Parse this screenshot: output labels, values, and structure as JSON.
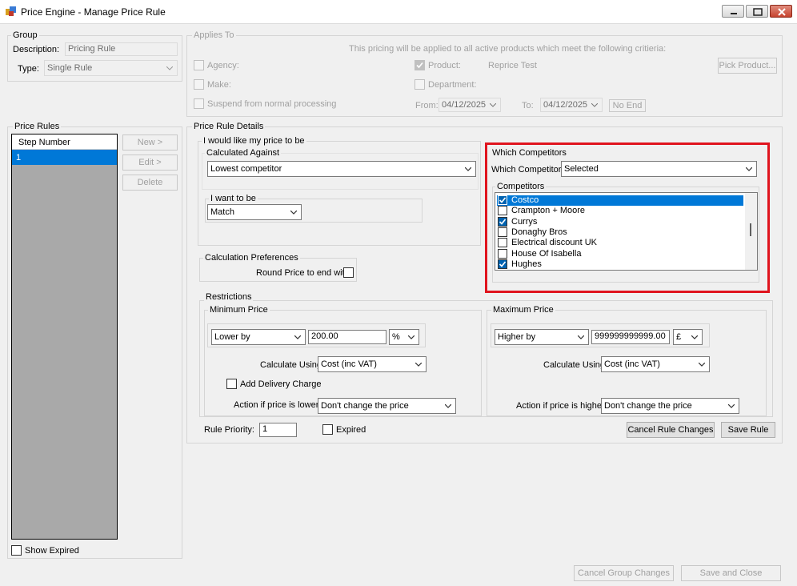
{
  "window": {
    "title": "Price Engine - Manage Price Rule"
  },
  "group": {
    "legend": "Group",
    "description_label": "Description:",
    "description_value": "Pricing Rule",
    "type_label": "Type:",
    "type_value": "Single Rule"
  },
  "applies_to": {
    "legend": "Applies To",
    "info": "This pricing will be applied to all active products which meet the following critieria:",
    "agency_label": "Agency:",
    "make_label": "Make:",
    "suspend_label": "Suspend from normal processing",
    "product_label": "Product:",
    "product_value": "Reprice Test",
    "department_label": "Department:",
    "pick_product_button": "Pick Product...",
    "from_label": "From:",
    "from_value": "04/12/2025",
    "to_label": "To:",
    "to_value": "04/12/2025",
    "no_end_button": "No End"
  },
  "price_rules": {
    "legend": "Price Rules",
    "column_header": "Step Number",
    "rows": [
      "1"
    ],
    "new_button": "New >",
    "edit_button": "Edit >",
    "delete_button": "Delete",
    "show_expired_label": "Show Expired"
  },
  "details": {
    "legend": "Price Rule Details",
    "want_legend": "I would like my price to be",
    "calc_against_legend": "Calculated Against",
    "calc_against_value": "Lowest competitor",
    "i_want_legend": "I want to be",
    "i_want_value": "Match",
    "calc_prefs_legend": "Calculation Preferences",
    "round_label": "Round Price to end with"
  },
  "competitors": {
    "legend": "Which Competitors",
    "which_label": "Which Competitors:",
    "which_value": "Selected",
    "list_legend": "Competitors",
    "items": [
      {
        "name": "Costco",
        "checked": true,
        "selected": true
      },
      {
        "name": "Crampton + Moore",
        "checked": false,
        "selected": false
      },
      {
        "name": "Currys",
        "checked": true,
        "selected": false
      },
      {
        "name": "Donaghy Bros",
        "checked": false,
        "selected": false
      },
      {
        "name": "Electrical discount UK",
        "checked": false,
        "selected": false
      },
      {
        "name": "House Of Isabella",
        "checked": false,
        "selected": false
      },
      {
        "name": "Hughes",
        "checked": true,
        "selected": false
      }
    ]
  },
  "restrictions": {
    "legend": "Restrictions",
    "min": {
      "legend": "Minimum Price",
      "direction": "Lower by",
      "amount": "200.00",
      "unit": "%",
      "calc_using_label": "Calculate Using:",
      "calc_using_value": "Cost (inc VAT)",
      "add_delivery_label": "Add Delivery Charge",
      "action_label": "Action if price is lower:",
      "action_value": "Don't change the price"
    },
    "max": {
      "legend": "Maximum Price",
      "direction": "Higher by",
      "amount": "999999999999.00",
      "unit": "£",
      "calc_using_label": "Calculate Using:",
      "calc_using_value": "Cost (inc VAT)",
      "action_label": "Action if price is higher:",
      "action_value": "Don't change the price"
    }
  },
  "rule_footer": {
    "priority_label": "Rule Priority:",
    "priority_value": "1",
    "expired_label": "Expired",
    "cancel_rule_button": "Cancel Rule Changes",
    "save_rule_button": "Save Rule"
  },
  "footer": {
    "cancel_group_button": "Cancel Group Changes",
    "save_close_button": "Save and Close"
  },
  "colors": {
    "highlight_border": "#e0141e",
    "selection": "#0078d7",
    "check": "#0063b1"
  }
}
